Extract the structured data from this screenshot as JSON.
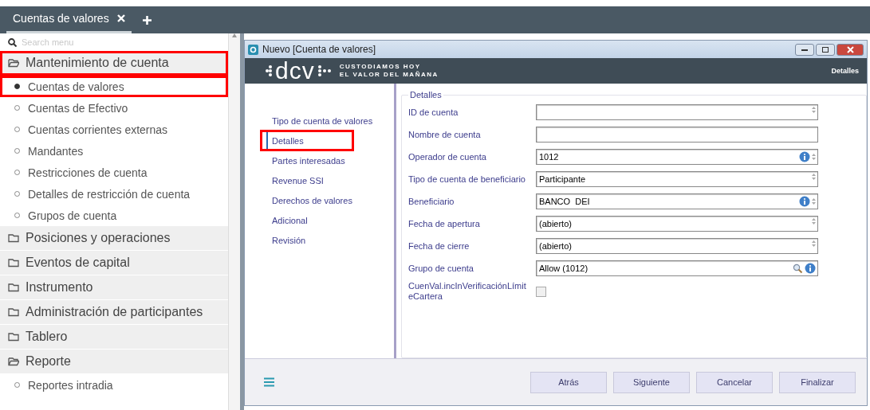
{
  "tab_bar": {
    "tabs": [
      {
        "label": "Cuentas de valores",
        "selected": true
      }
    ]
  },
  "sidebar": {
    "search": {
      "placeholder": "Search menu"
    },
    "items": [
      {
        "label": "Mantenimiento de cuenta",
        "expanded": true,
        "highlighted": true,
        "children": [
          {
            "label": "Cuentas de valores",
            "selected": true,
            "highlighted": true
          },
          {
            "label": "Cuentas de Efectivo",
            "selected": false,
            "highlighted": false
          },
          {
            "label": "Cuentas corrientes externas",
            "selected": false,
            "highlighted": false
          },
          {
            "label": "Mandantes",
            "selected": false,
            "highlighted": false
          },
          {
            "label": "Restricciones de cuenta",
            "selected": false,
            "highlighted": false
          },
          {
            "label": "Detalles de restricción de cuenta",
            "selected": false,
            "highlighted": false
          },
          {
            "label": "Grupos de cuenta",
            "selected": false,
            "highlighted": false
          }
        ]
      },
      {
        "label": "Posiciones y operaciones",
        "expanded": false,
        "highlighted": false
      },
      {
        "label": "Eventos de capital",
        "expanded": false,
        "highlighted": false
      },
      {
        "label": "Instrumento",
        "expanded": false,
        "highlighted": false
      },
      {
        "label": "Administración de participantes",
        "expanded": false,
        "highlighted": false
      },
      {
        "label": "Tablero",
        "expanded": false,
        "highlighted": false
      },
      {
        "label": "Reporte",
        "expanded": true,
        "highlighted": false,
        "children": [
          {
            "label": "Reportes intradia",
            "selected": false,
            "highlighted": false
          }
        ]
      }
    ]
  },
  "dialog": {
    "title": "Nuevo [Cuenta de valores]",
    "banner": {
      "logo": "dcv",
      "tagline": [
        "CUSTODIAMOS HOY",
        "EL VALOR DEL MAÑANA"
      ],
      "section": "Detalles"
    },
    "steps": [
      {
        "label": "Tipo de cuenta de valores",
        "selected": false,
        "highlighted": false
      },
      {
        "label": "Detalles",
        "selected": true,
        "highlighted": true
      },
      {
        "label": "Partes interesadas",
        "selected": false,
        "highlighted": false
      },
      {
        "label": "Revenue SSI",
        "selected": false,
        "highlighted": false
      },
      {
        "label": "Derechos de valores",
        "selected": false,
        "highlighted": false
      },
      {
        "label": "Adicional",
        "selected": false,
        "highlighted": false
      },
      {
        "label": "Revisión",
        "selected": false,
        "highlighted": false
      }
    ],
    "fieldset": {
      "legend": "Detalles",
      "fields": [
        {
          "kind": "text",
          "label": "ID de cuenta",
          "info": false,
          "lookup": false,
          "spinner": true
        },
        {
          "kind": "text",
          "label": "Nombre de cuenta",
          "info": false,
          "lookup": false,
          "spinner": false
        },
        {
          "kind": "text",
          "label": "Operador de cuenta",
          "value": "1012",
          "info": true,
          "lookup": false,
          "spinner": true
        },
        {
          "kind": "text",
          "label": "Tipo de cuenta de beneficiario",
          "value": "Participante",
          "info": false,
          "lookup": false,
          "spinner": true
        },
        {
          "kind": "text",
          "label": "Beneficiario",
          "value": "BANCO  DEI",
          "info": true,
          "lookup": false,
          "spinner": true
        },
        {
          "kind": "text",
          "label": "Fecha de apertura",
          "value": "(abierto)",
          "info": false,
          "lookup": false,
          "spinner": true
        },
        {
          "kind": "text",
          "label": "Fecha de cierre",
          "value": "(abierto)",
          "info": false,
          "lookup": false,
          "spinner": true
        },
        {
          "kind": "text",
          "label": "Grupo de cuenta",
          "value": "Allow (1012)",
          "info": true,
          "lookup": true,
          "spinner": false
        },
        {
          "kind": "checkbox",
          "label": "CuenVal.incInVerificaciónLímiteCartera",
          "checked": false
        }
      ]
    },
    "buttons": [
      "Atrás",
      "Siguiente",
      "Cancelar",
      "Finalizar"
    ]
  }
}
